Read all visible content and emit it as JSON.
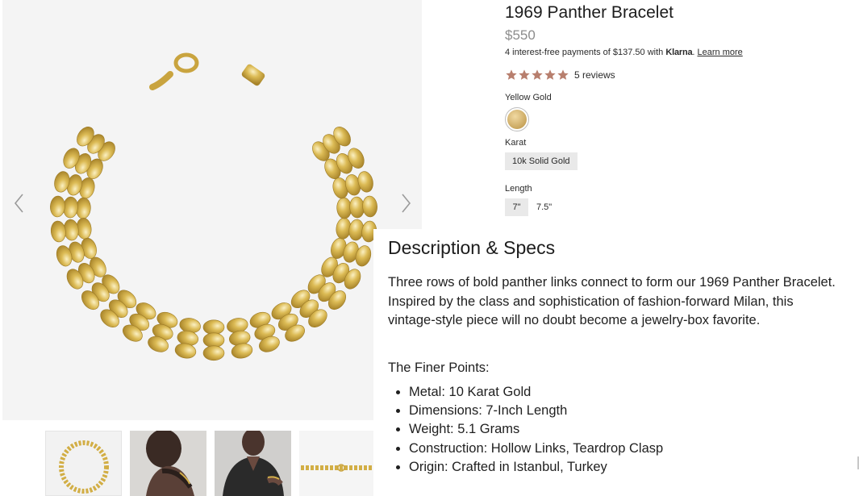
{
  "product": {
    "title": "1969 Panther Bracelet",
    "price": "$550",
    "klarna": {
      "prefix": "4 interest-free payments of $137.50 with ",
      "brand": "Klarna",
      "suffix": ". ",
      "link": "Learn more"
    },
    "rating": {
      "stars": 5,
      "max": 5,
      "reviews_label": "5 reviews",
      "star_color": "#b87f6e"
    },
    "color_label": "Yellow Gold",
    "karat_label": "Karat",
    "karat_option": "10k Solid Gold",
    "length_label": "Length",
    "length_options": [
      "7\"",
      "7.5\""
    ]
  },
  "gallery": {
    "prev_icon": "chevron-left-icon",
    "next_icon": "chevron-right-icon"
  },
  "description": {
    "heading": "Description & Specs",
    "body": "Three rows of bold panther links connect to form our 1969 Panther Bracelet. Inspired by the class and sophistication of fashion-forward Milan, this vintage-style piece will no doubt become a jewelry-box favorite.",
    "finer_label": "The Finer Points:",
    "points": [
      "Metal: 10 Karat Gold",
      "Dimensions: 7-Inch Length",
      "Weight: 5.1 Grams",
      "Construction: Hollow Links, Teardrop Clasp",
      "Origin: Crafted in Istanbul, Turkey"
    ]
  },
  "colors": {
    "gold": "#d8b44a",
    "gold_dark": "#a8842a",
    "gold_light": "#f4e3a0",
    "muted_price": "#8c8c8c"
  }
}
